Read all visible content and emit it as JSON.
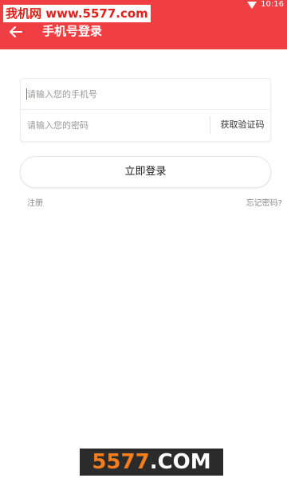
{
  "status_bar": {
    "time": "10:16",
    "icons": [
      "wifi-icon"
    ],
    "color": "#ef3f42"
  },
  "watermark_top": {
    "text": "我机网 www.5577.com"
  },
  "header": {
    "title": "手机号登录",
    "back_icon": "arrow-left-icon",
    "background": "#ef3f42"
  },
  "form": {
    "phone_placeholder": "请输入您的手机号",
    "phone_value": "",
    "code_placeholder": "请输入您的密码",
    "code_value": "",
    "get_code_label": "获取验证码"
  },
  "login_button": {
    "label": "立即登录"
  },
  "links": {
    "register": "注册",
    "forgot_password": "忘记密码?"
  },
  "watermark_bottom": {
    "number": "5577",
    "suffix": ".COM"
  }
}
